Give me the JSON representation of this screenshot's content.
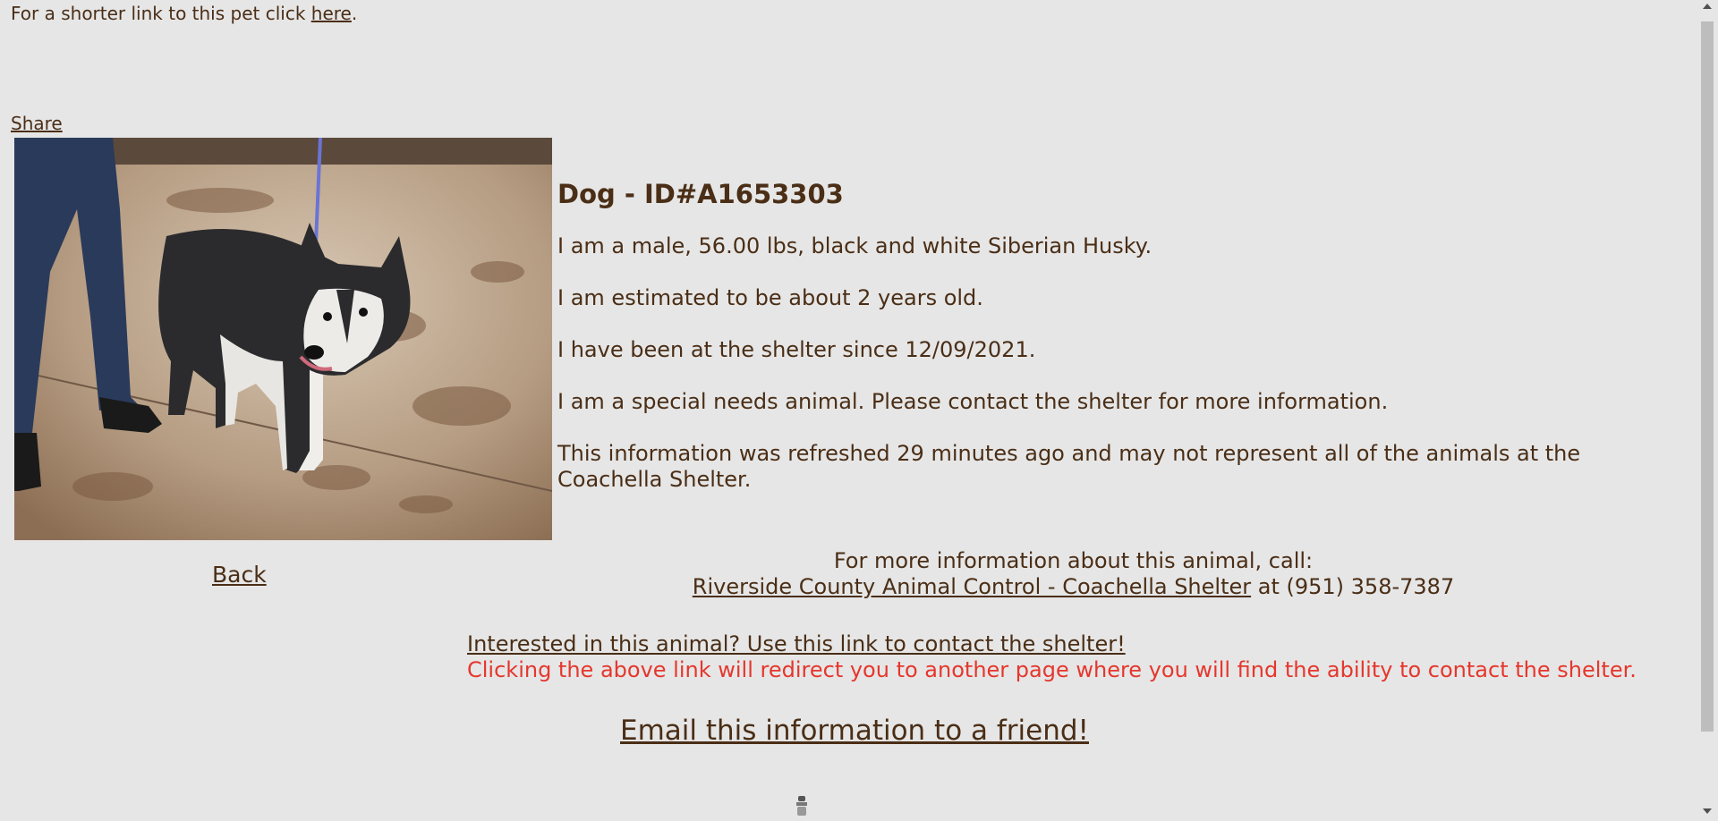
{
  "header": {
    "shortlink_prefix": "For a shorter link to this pet click ",
    "shortlink_link": "here",
    "shortlink_suffix": ".",
    "share_label": "Share"
  },
  "photo": {
    "icon": "dog-photo"
  },
  "nav": {
    "back_label": "Back"
  },
  "animal": {
    "title": "Dog - ID#A1653303",
    "description": "I am a male, 56.00 lbs, black and white Siberian Husky.",
    "age": "I am estimated to be about 2 years old.",
    "since": "I have been at the shelter since 12/09/2021.",
    "special_needs": "I am a special needs animal. Please contact the shelter for more information.",
    "refresh_note": "This information was refreshed 29 minutes ago and may not represent all of the animals at the Coachella Shelter."
  },
  "contact": {
    "prompt": "For more information about this animal, call:",
    "shelter_link": "Riverside County Animal Control - Coachella Shelter",
    "phone_text": " at (951) 358-7387"
  },
  "interest": {
    "link": "Interested in this animal? Use this link to contact the shelter!",
    "warning": "Clicking the above link will redirect you to another page where you will find the ability to contact the shelter."
  },
  "email": {
    "link": "Email this information to a friend!"
  },
  "colors": {
    "background": "#e6e6e6",
    "text": "#4a2e16",
    "warning": "#e5372d"
  }
}
